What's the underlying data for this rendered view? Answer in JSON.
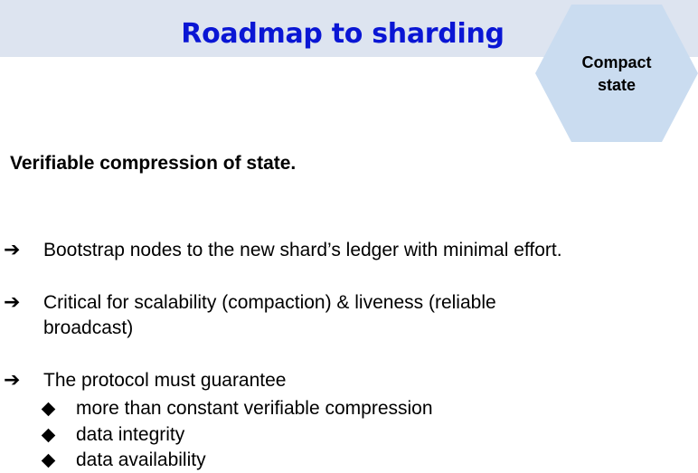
{
  "slide": {
    "title": "Roadmap to sharding",
    "badge": {
      "line1": "Compact",
      "line2": "state"
    },
    "subtitle": "Verifiable compression of state.",
    "bullets": [
      {
        "text": "Bootstrap nodes to the new shard’s ledger with minimal effort."
      },
      {
        "text": "Critical for scalability (compaction) & liveness (reliable broadcast)"
      },
      {
        "text": "The protocol must guarantee"
      }
    ],
    "sub_bullets": [
      {
        "text": "more than constant verifiable compression"
      },
      {
        "text": "data integrity"
      },
      {
        "text": "data availability"
      }
    ],
    "bullet_marker": "➔",
    "colors": {
      "title": "#0a16d4",
      "title_band": "#dde4f0",
      "hexagon": "#cadcf0"
    }
  }
}
